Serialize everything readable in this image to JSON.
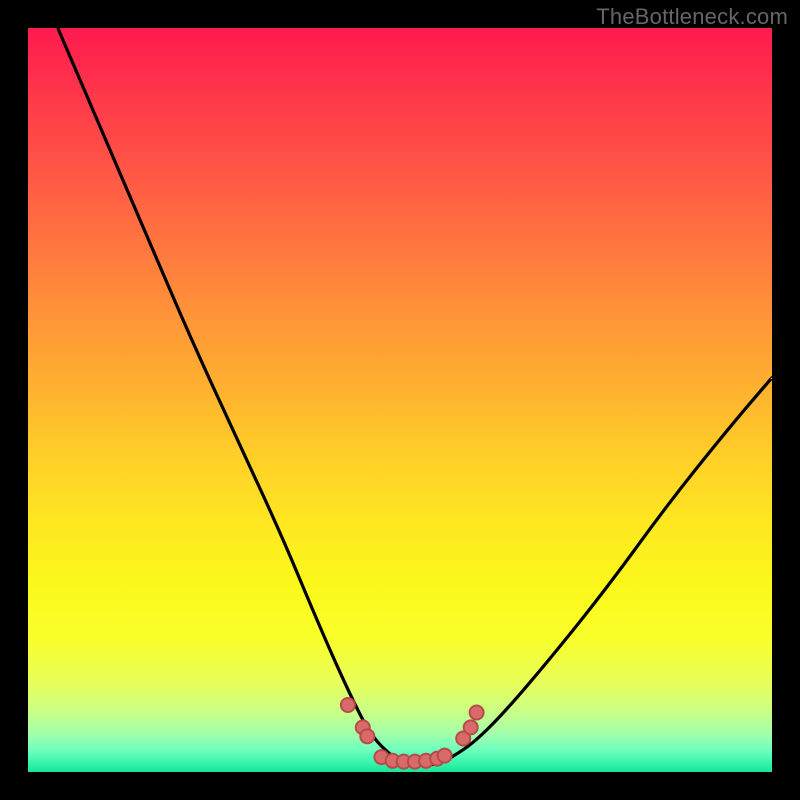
{
  "watermark": "TheBottleneck.com",
  "chart_data": {
    "type": "line",
    "title": "",
    "xlabel": "",
    "ylabel": "",
    "xlim": [
      0,
      100
    ],
    "ylim": [
      0,
      100
    ],
    "grid": false,
    "legend": false,
    "series": [
      {
        "name": "bottleneck-curve",
        "comment": "y = bottleneck percentage (0 at bottom), x = relative hardware balance; values read from pixel positions since no axis ticks are printed",
        "x": [
          4,
          10,
          16,
          22,
          28,
          34,
          39,
          43,
          46,
          49,
          51,
          53,
          55,
          57,
          60,
          64,
          70,
          78,
          86,
          94,
          100
        ],
        "y": [
          100,
          86,
          72,
          58,
          45,
          32,
          20,
          11,
          5,
          2,
          1,
          1,
          1,
          2,
          4,
          8,
          15,
          25,
          36,
          46,
          53
        ]
      }
    ],
    "markers": {
      "comment": "salmon dots clustered in the valley region",
      "x": [
        43.0,
        45.0,
        45.6,
        47.5,
        49.0,
        50.5,
        52.0,
        53.5,
        55.0,
        56.0,
        58.5,
        59.5,
        60.3
      ],
      "y": [
        9.0,
        6.0,
        4.8,
        2.0,
        1.5,
        1.4,
        1.4,
        1.5,
        1.8,
        2.2,
        4.5,
        6.0,
        8.0
      ]
    },
    "background_gradient": {
      "direction": "top-to-bottom",
      "stops": [
        {
          "pos": 0.0,
          "color": "#ff1a4e"
        },
        {
          "pos": 0.5,
          "color": "#ffd028"
        },
        {
          "pos": 0.82,
          "color": "#f9ff2b"
        },
        {
          "pos": 1.0,
          "color": "#16e69a"
        }
      ]
    },
    "frame_color": "#000000"
  }
}
